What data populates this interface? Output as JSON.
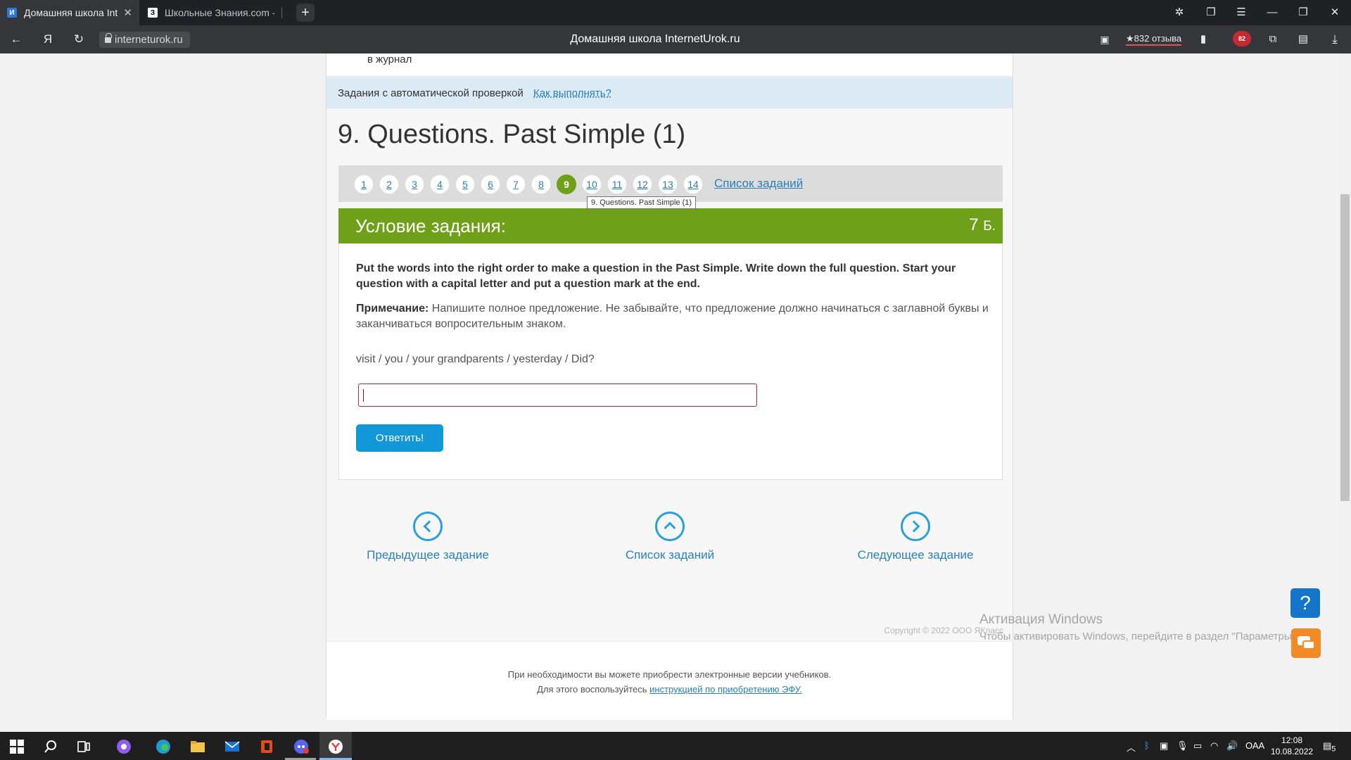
{
  "browser": {
    "tabs": [
      {
        "title": "Домашняя школа Inter",
        "favicon": "И",
        "active": true
      },
      {
        "title": "Школьные Знания.com - ",
        "favicon": "З",
        "active": false
      }
    ],
    "url": "interneturok.ru",
    "window_title": "Домашняя школа InternetUrok.ru",
    "reviews": "★832 отзыва",
    "adblock_count": "82"
  },
  "page": {
    "journal_text": "в журнал",
    "autocheck_label": "Задания с автоматической проверкой",
    "howto_link": "Как выполнять?",
    "title": "9. Questions. Past Simple (1)",
    "pager": {
      "numbers": [
        "1",
        "2",
        "3",
        "4",
        "5",
        "6",
        "7",
        "8",
        "9",
        "10",
        "11",
        "12",
        "13",
        "14"
      ],
      "active": "9",
      "list_link": "Список заданий",
      "tooltip": "9. Questions. Past Simple (1)"
    },
    "task": {
      "heading": "Условие задания:",
      "points": "7",
      "points_unit": "Б.",
      "instruction": "Put the words into the right order to make a question in the Past Simple. Write down the full question. Start your question with a capital letter and put a question mark at the end.",
      "note_label": "Примечание:",
      "note_text": " Напишите полное предложение. Не забывайте, что предложение должно начинаться с заглавной буквы и заканчиваться вопросительным знаком.",
      "words": "visit / you / your grandparents / yesterday / Did?",
      "answer_value": "",
      "submit_label": "Ответить!"
    },
    "bottom_nav": {
      "prev": "Предыдущее задание",
      "list": "Список заданий",
      "next": "Следующее задание"
    },
    "copyright": "Copyright © 2022 ООО ЯКласс",
    "footer": {
      "line1": "При необходимости вы можете приобрести электронные версии учебников.",
      "line2_prefix": "Для этого воспользуйтесь ",
      "line2_link": "инструкцией по приобретению ЭФУ."
    },
    "windows_activation": {
      "title": "Активация Windows",
      "text": "Чтобы активировать Windows, перейдите в раздел \"Параметры\""
    },
    "help_label": "?"
  },
  "taskbar": {
    "language": "ОАА",
    "time": "12:08",
    "date": "10.08.2022",
    "notifications": "5"
  }
}
